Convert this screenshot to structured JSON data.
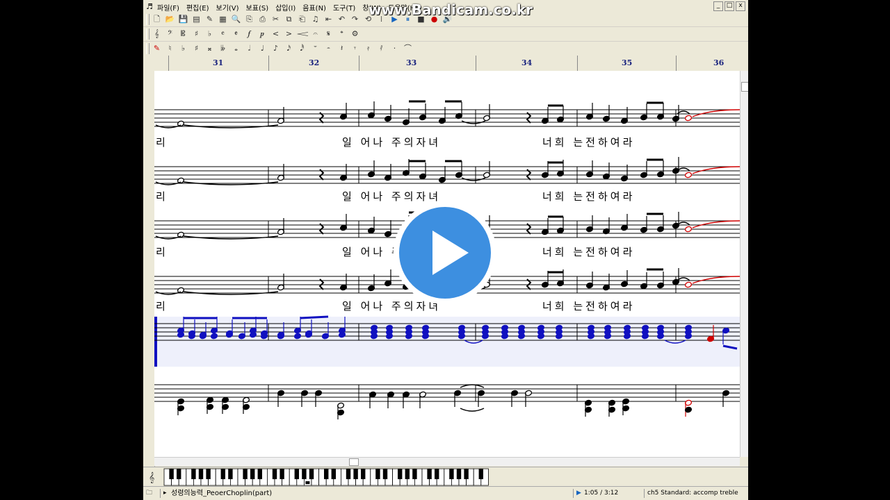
{
  "watermark": "www.Bandicam.co.kr",
  "window": {
    "menus": [
      "파일(F)",
      "편집(E)",
      "보기(V)",
      "보표(S)",
      "삽입(I)",
      "음표(N)",
      "도구(T)",
      "창(W)",
      "도움말(H)"
    ],
    "window_buttons": [
      "_",
      "□",
      "x"
    ]
  },
  "ruler": {
    "measures": [
      "31",
      "32",
      "33",
      "34",
      "35",
      "36"
    ]
  },
  "lyrics": {
    "line_start": "리",
    "left_group": "일 어나 주의자녀",
    "right_group": "너희 는전하여라"
  },
  "status": {
    "file_name": "성령의능력_PeoerChoplin(part)",
    "time": "1:05 / 3:12",
    "instrument": "ch5 Standard: accomp treble"
  },
  "colors": {
    "staff": "#000000",
    "accompaniment": "#1010c0",
    "highlight": "#d00000",
    "player_blue": "#3d8fe0"
  },
  "icons": [
    "app-icon",
    "new-file-icon",
    "open-icon",
    "save-icon",
    "play-icon",
    "stop-icon",
    "record-icon",
    "piano-keyboard-icon",
    "play-overlay-icon"
  ]
}
